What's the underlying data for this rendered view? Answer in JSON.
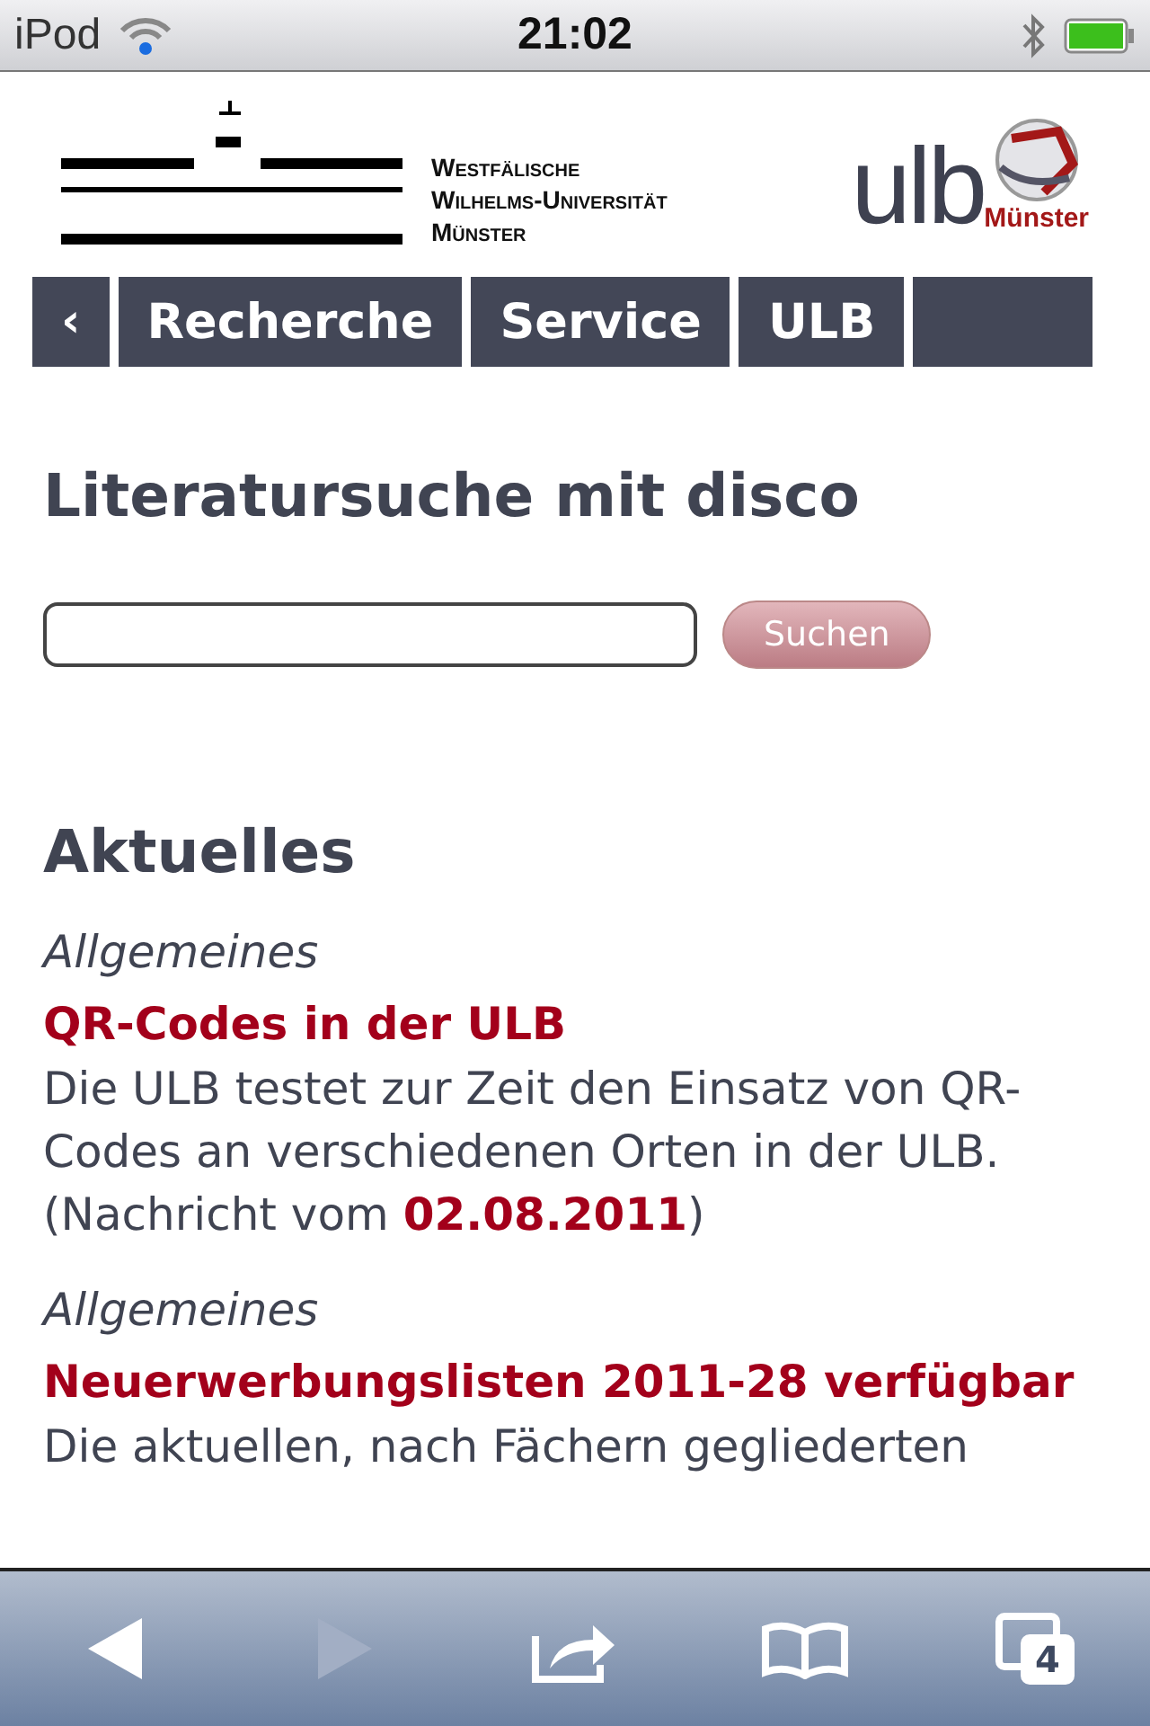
{
  "status_bar": {
    "carrier": "iPod",
    "time": "21:02"
  },
  "header": {
    "university": [
      "Westfälische",
      "Wilhelms-Universität",
      "Münster"
    ],
    "library_logo": {
      "name": "ulb",
      "city": "Münster"
    }
  },
  "nav": {
    "items": [
      {
        "kind": "back",
        "label": "‹"
      },
      {
        "kind": "link",
        "label": "Recherche"
      },
      {
        "kind": "link",
        "label": "Service"
      },
      {
        "kind": "link",
        "label": "ULB"
      },
      {
        "kind": "empty"
      }
    ]
  },
  "search": {
    "heading": "Literatursuche mit disco",
    "button": "Suchen"
  },
  "news": {
    "heading": "Aktuelles",
    "items": [
      {
        "category": "Allgemeines",
        "title": "QR-Codes in der ULB",
        "text": "Die ULB testet zur Zeit den Einsatz von QR-Codes an verschiedenen Orten in der ULB. (Nachricht vom **02.08.2011**)"
      },
      {
        "category": "Allgemeines",
        "title": "Neuerwerbungslisten 2011-28 verfügbar",
        "text": "Die aktuellen, nach Fächern gegliederten"
      }
    ]
  },
  "toolbar": {
    "buttons": [
      {
        "kind": "back",
        "disabled": false
      },
      {
        "kind": "forward",
        "disabled": true
      },
      {
        "kind": "share",
        "disabled": false
      },
      {
        "kind": "bookmarks",
        "disabled": false
      },
      {
        "kind": "pages",
        "disabled": false,
        "count": "4"
      }
    ]
  }
}
